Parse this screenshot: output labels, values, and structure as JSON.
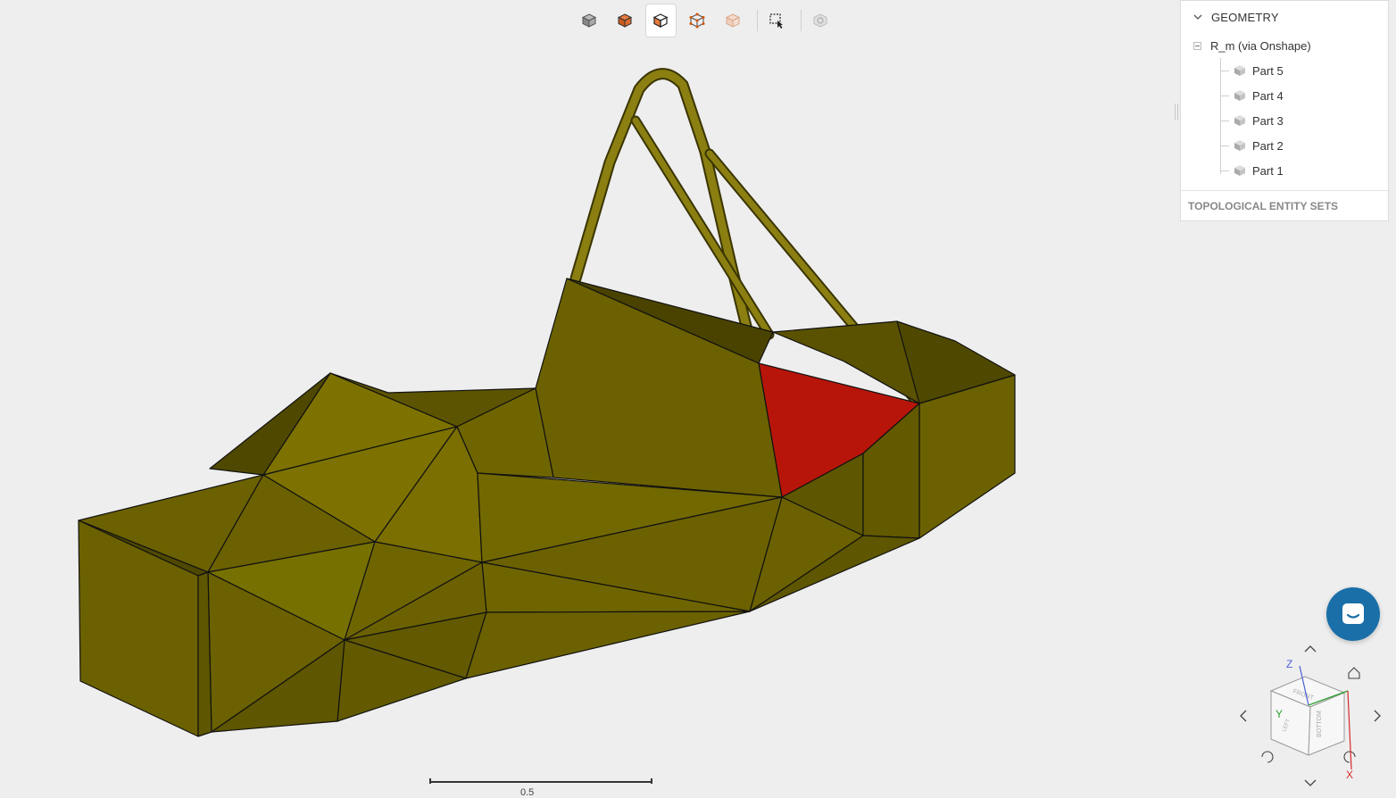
{
  "toolbar": {
    "items": [
      "solid-view",
      "solid-edges-view",
      "selected-view",
      "points-view",
      "transparent-view",
      "box-select",
      "settings"
    ],
    "active": "selected-view"
  },
  "tree": {
    "header": "GEOMETRY",
    "root": "R_m (via Onshape)",
    "parts": [
      "Part 5",
      "Part 4",
      "Part 3",
      "Part 2",
      "Part 1"
    ],
    "sets_label": "TOPOLOGICAL ENTITY SETS"
  },
  "scale": {
    "label": "0.5"
  },
  "axes": {
    "x": "X",
    "y": "Y",
    "z": "Z"
  },
  "colors": {
    "body": "#6b6100",
    "body_light": "#7d7200",
    "body_dark": "#4f4800",
    "selected_face": "#b8150a",
    "accent": "#1a6fa8"
  }
}
